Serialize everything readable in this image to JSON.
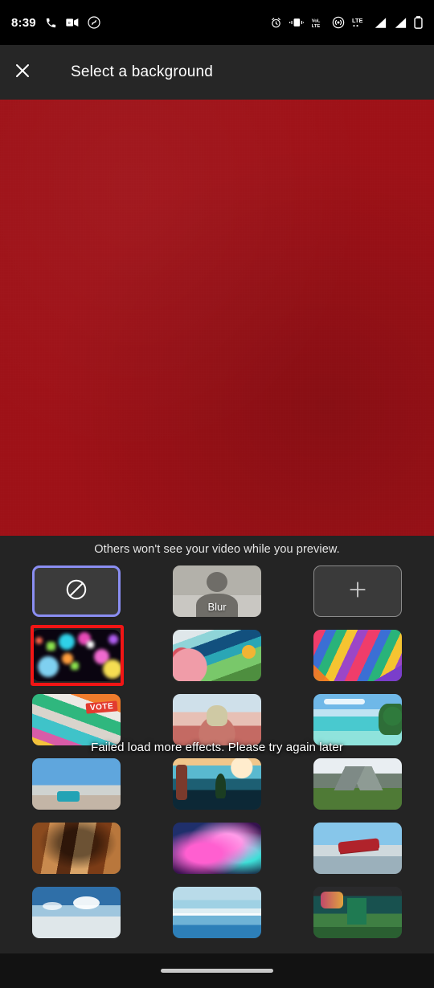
{
  "status_bar": {
    "time": "8:39",
    "left_icons": [
      "phone-icon",
      "outlook-icon",
      "shazam-icon"
    ],
    "right_icons": [
      "alarm-icon",
      "vibrate-icon",
      "volte-icon",
      "hotspot-icon",
      "lte-icon",
      "signal-bars-1-icon",
      "signal-bars-2-icon",
      "battery-icon"
    ],
    "network_label": "LTE",
    "volte_label_top": "VoL",
    "volte_label_bottom": "LTE"
  },
  "header": {
    "title": "Select a background",
    "close_icon": "close-icon"
  },
  "preview": {
    "background_color": "#9e1117"
  },
  "sheet": {
    "note": "Others won't see your video while you preview.",
    "toast": "Failed load more effects. Please try again later",
    "selected_accent_color": "#8a8ef2",
    "highlight_color": "#f21515",
    "controls": [
      {
        "name": "no-effect",
        "label": "",
        "icon": "no-effect-icon",
        "selected": true
      },
      {
        "name": "blur",
        "label": "Blur",
        "icon": "person-silhouette-icon",
        "selected": false
      },
      {
        "name": "add-background",
        "label": "",
        "icon": "plus-icon",
        "selected": false
      }
    ],
    "effects": [
      {
        "name": "bokeh-lights",
        "highlighted": true
      },
      {
        "name": "abstract-painted-landscape",
        "highlighted": false
      },
      {
        "name": "colorful-abstract-blocks",
        "highlighted": false
      },
      {
        "name": "vote-graphic",
        "highlighted": false
      },
      {
        "name": "pastel-still-life",
        "highlighted": false
      },
      {
        "name": "tropical-beach",
        "highlighted": false
      },
      {
        "name": "desert-sky-bus",
        "highlighted": false
      },
      {
        "name": "fantasy-moon-landscape",
        "highlighted": false
      },
      {
        "name": "mountain-valley",
        "highlighted": false
      },
      {
        "name": "slot-canyon",
        "highlighted": false
      },
      {
        "name": "pink-galaxy",
        "highlighted": false
      },
      {
        "name": "red-biplane",
        "highlighted": false
      },
      {
        "name": "sky-clouds",
        "highlighted": false
      },
      {
        "name": "ocean-horizon",
        "highlighted": false
      },
      {
        "name": "office-interior",
        "highlighted": false
      }
    ]
  },
  "nav_bar": {
    "gesture_pill": "home-gesture-pill"
  }
}
